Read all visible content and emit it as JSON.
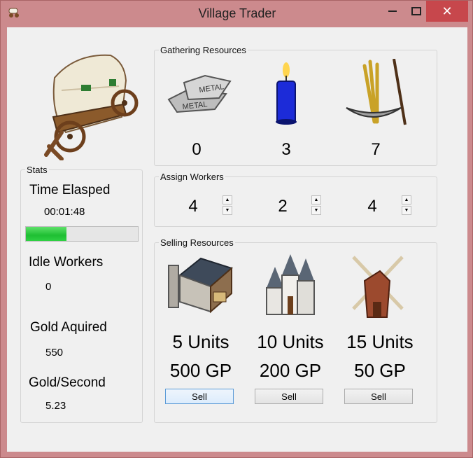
{
  "window": {
    "title": "Village Trader",
    "close_glyph": "✕",
    "app_icon": "wagon-icon"
  },
  "colors": {
    "titlebar": "#cc8a8d",
    "close": "#c7474c",
    "progress": "#2fd043",
    "client": "#f0f0f0"
  },
  "stats": {
    "group_title": "Stats",
    "time_label": "Time Elasped",
    "time_value": "00:01:48",
    "progress_fraction": 0.36,
    "idle_label": "Idle Workers",
    "idle_value": "0",
    "gold_label": "Gold Aquired",
    "gold_value": "550",
    "gps_label": "Gold/Second",
    "gps_value": "5.23"
  },
  "gathering": {
    "group_title": "Gathering Resources",
    "resources": [
      {
        "icon": "metal-ingot-icon",
        "count": "0"
      },
      {
        "icon": "candle-icon",
        "count": "3"
      },
      {
        "icon": "wheat-scythe-icon",
        "count": "7"
      }
    ]
  },
  "workers": {
    "group_title": "Assign Workers",
    "values": [
      "4",
      "2",
      "4"
    ]
  },
  "selling": {
    "group_title": "Selling Resources",
    "markets": [
      {
        "icon": "blacksmith-icon",
        "units": "5 Units",
        "price": "500 GP",
        "button": "Sell"
      },
      {
        "icon": "church-icon",
        "units": "10 Units",
        "price": "200 GP",
        "button": "Sell"
      },
      {
        "icon": "windmill-icon",
        "units": "15 Units",
        "price": "50 GP",
        "button": "Sell"
      }
    ]
  }
}
